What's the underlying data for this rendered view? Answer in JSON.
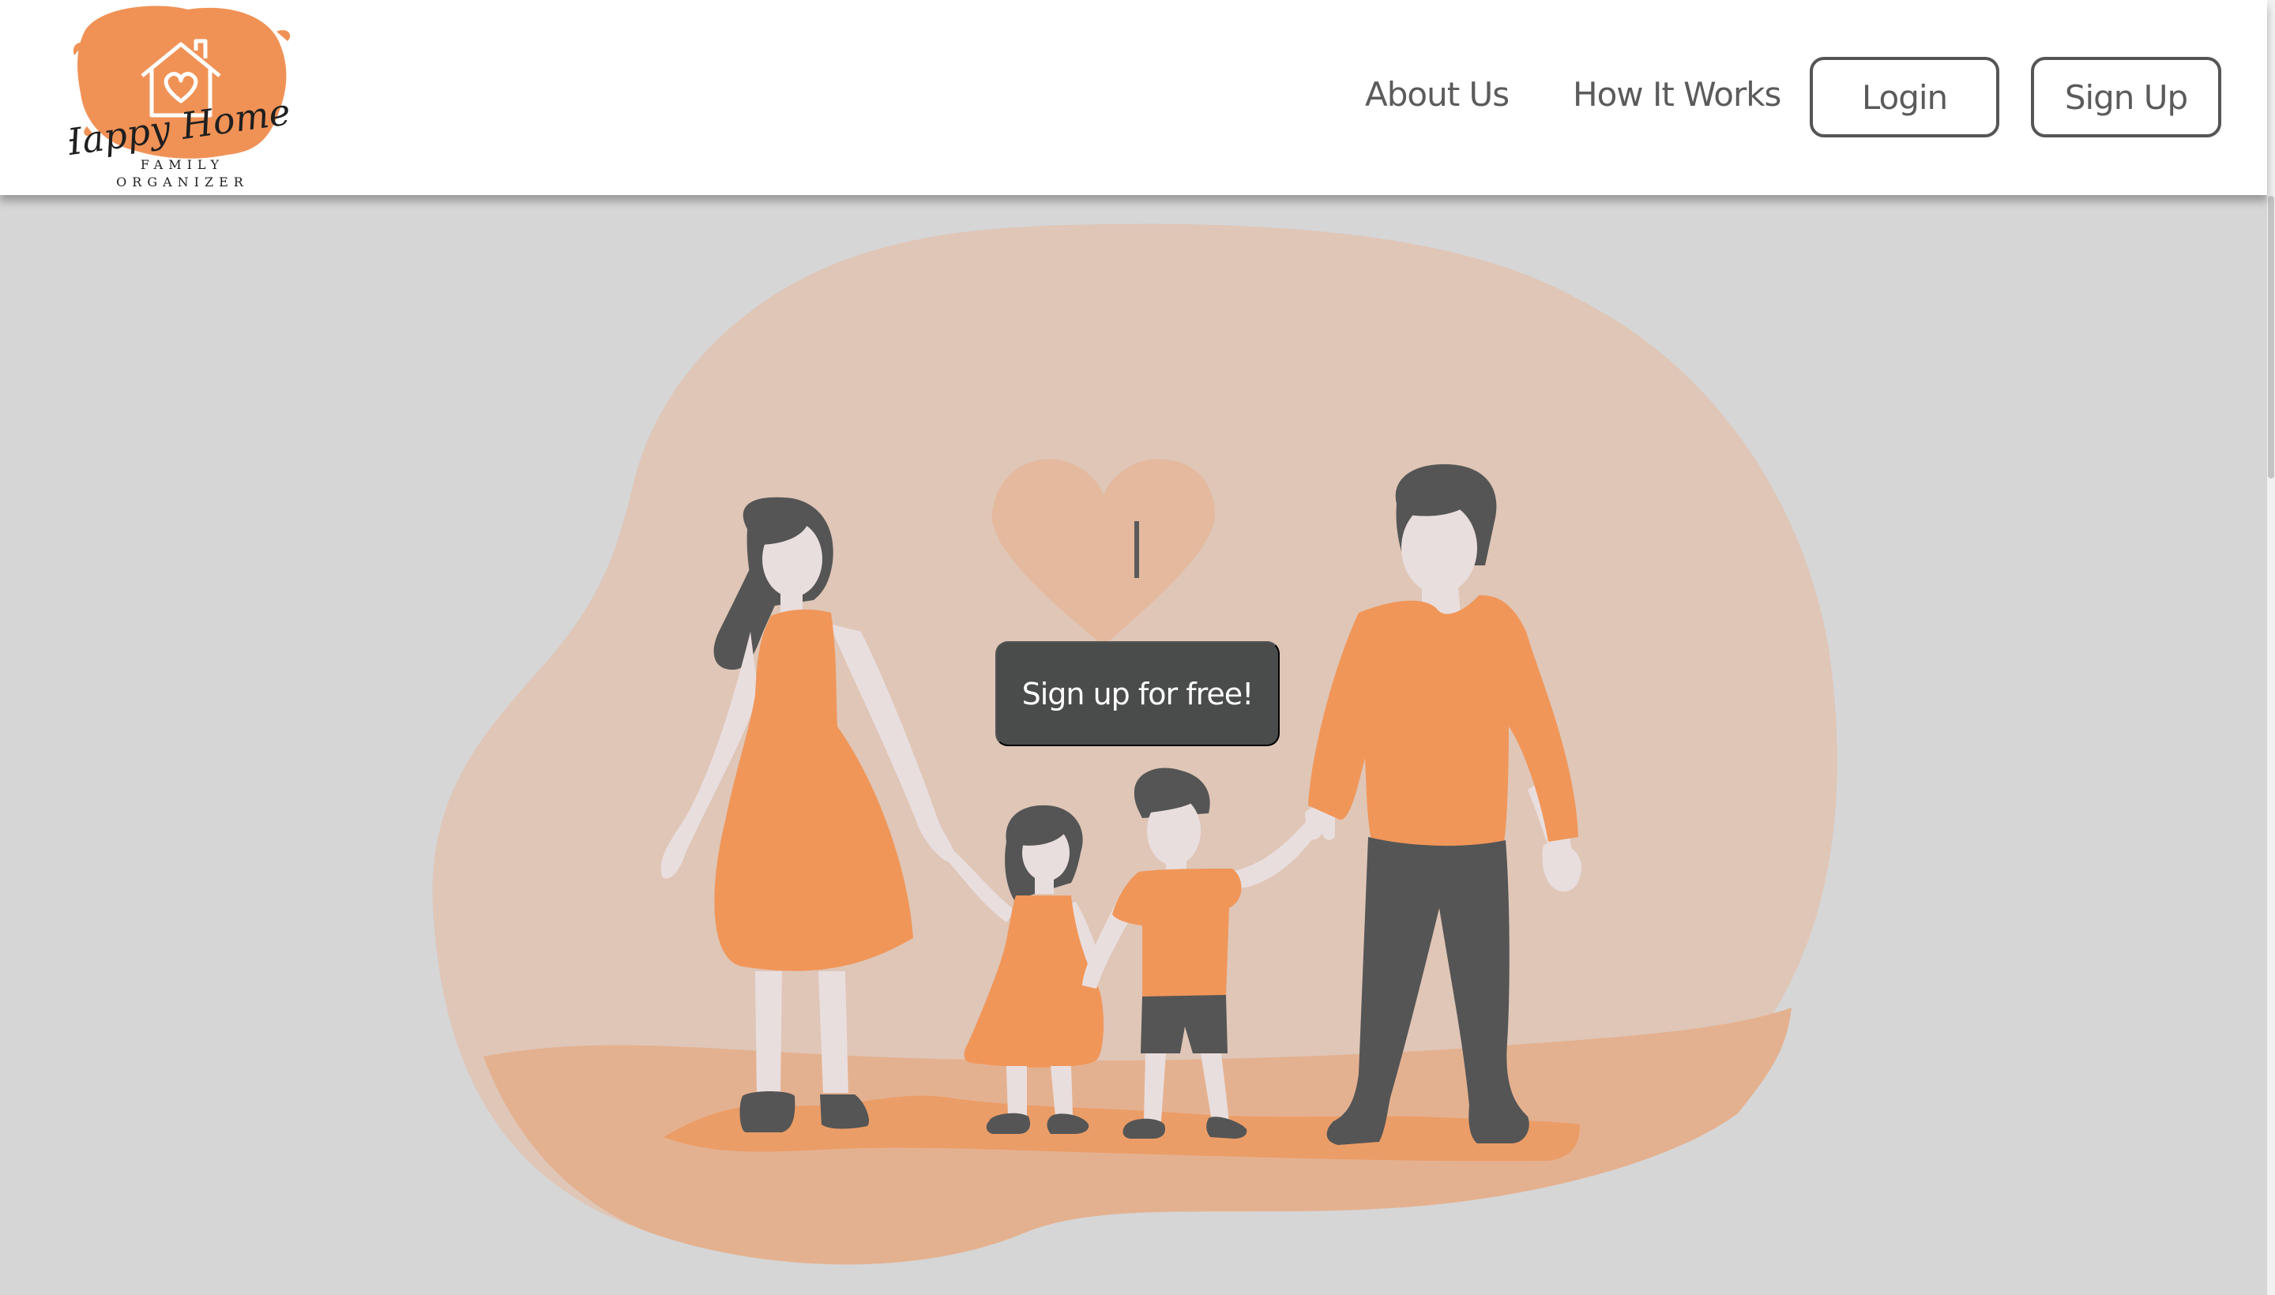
{
  "brand": {
    "logo_script": "Happy Home",
    "logo_line1": "FAMILY",
    "logo_line2": "ORGANIZER",
    "logo_color": "#f09256"
  },
  "nav": {
    "about_label": "About Us",
    "how_label": "How It Works",
    "login_label": "Login",
    "signup_label": "Sign Up"
  },
  "hero": {
    "cta_label": "Sign up for free!",
    "blob_color": "#dfc6b7",
    "ground_color": "#e4b190",
    "accent_color": "#f09659",
    "dark_color": "#5e5e5e",
    "skin_color": "#e9dede"
  },
  "icons": {
    "logo_house": "house-heart-icon",
    "hero_heart": "heart-icon"
  }
}
